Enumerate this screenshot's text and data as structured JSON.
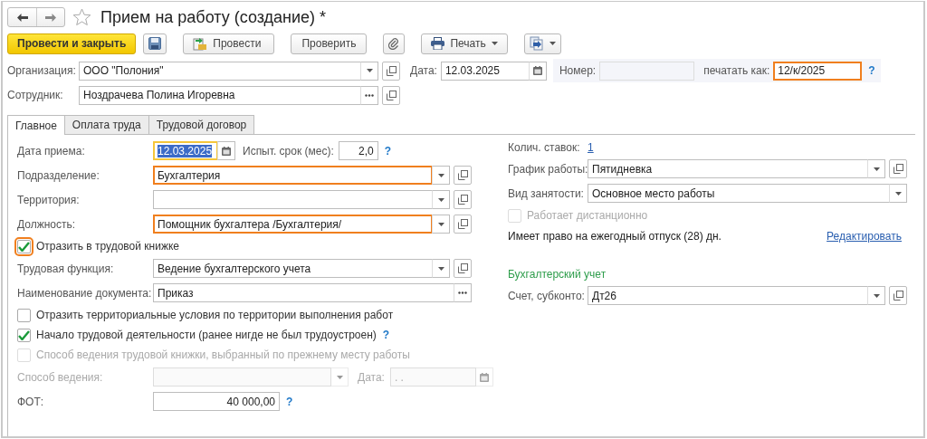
{
  "window": {
    "title": "Прием на работу (создание) *"
  },
  "toolbar": [
    {
      "kind": "primary",
      "label": "Провести и закрыть"
    },
    {
      "kind": "save"
    },
    {
      "kind": "post",
      "label": "Провести"
    },
    {
      "kind": "plain",
      "label": "Проверить"
    },
    {
      "kind": "attach"
    },
    {
      "kind": "print",
      "label": "Печать",
      "menu": true
    },
    {
      "kind": "exchange",
      "menu": true
    }
  ],
  "header": {
    "organization": {
      "label": "Организация:",
      "value": "ООО \"Полония\""
    },
    "date": {
      "label": "Дата:",
      "value": "12.03.2025"
    },
    "number": {
      "label": "Номер:"
    },
    "print_as": {
      "label": "печатать как:",
      "value": "12/к/2025",
      "highlighted": true,
      "help": "?"
    },
    "employee": {
      "label": "Сотрудник:",
      "value": "Ноздрачева Полина Игоревна"
    }
  },
  "tabs": [
    {
      "label": "Главное",
      "selected": true
    },
    {
      "label": "Оплата труда",
      "selected": false
    },
    {
      "label": "Трудовой договор",
      "selected": false
    }
  ],
  "main": {
    "hire_date": {
      "label": "Дата приема:",
      "value": "12.03.2025",
      "focused": true,
      "text_selected": true
    },
    "trial": {
      "label": "Испыт. срок (мес):",
      "value": "2,0",
      "help": "?"
    },
    "rows": [
      {
        "kind": "select",
        "label": "Подразделение:",
        "value": "Бухгалтерия",
        "highlighted": true,
        "open_button": true
      },
      {
        "kind": "select",
        "label": "Территория:",
        "open_button": true
      },
      {
        "kind": "select",
        "label": "Должность:",
        "value": "Помощник бухгалтера /Бухгалтерия/",
        "highlighted": true,
        "open_button": true
      },
      {
        "kind": "checkbox",
        "label": "Отразить в трудовой книжке",
        "checked": true,
        "highlighted": true,
        "disabled": false
      },
      {
        "kind": "select",
        "label": "Трудовая функция:",
        "value": "Ведение бухгалтерского учета",
        "open_button": true
      },
      {
        "kind": "choice",
        "label": "Наименование документа:",
        "value": "Приказ"
      },
      {
        "kind": "checkbox",
        "label": "Отразить территориальные условия по территории выполнения работ",
        "checked": false,
        "disabled": false
      },
      {
        "kind": "checkbox",
        "label": "Начало трудовой деятельности (ранее нигде не был трудоустроен)",
        "checked": true,
        "disabled": false,
        "help": "?"
      },
      {
        "kind": "checkbox",
        "label": "Способ ведения трудовой книжки, выбранный по прежнему месту работы",
        "checked": false,
        "disabled": true
      },
      {
        "kind": "method",
        "label": "Способ ведения:",
        "disabled": true,
        "date_label": "Дата:",
        "date_value": ".  ."
      },
      {
        "kind": "number",
        "label": "ФОТ:",
        "value": "40 000,00",
        "help": "?"
      }
    ]
  },
  "side": {
    "rate": {
      "label": "Колич. ставок:",
      "value": "1"
    },
    "rows": [
      {
        "kind": "select",
        "label": "График работы:",
        "value": "Пятидневка",
        "open_button": true
      },
      {
        "kind": "select",
        "label": "Вид занятости:",
        "value": "Основное место работы",
        "open_button": false
      },
      {
        "kind": "checkbox",
        "label": "Работает дистанционно",
        "checked": false,
        "disabled": true
      }
    ],
    "vacation": {
      "text": "Имеет право на ежегодный отпуск (28) дн.",
      "link": "Редактировать"
    },
    "accounting": {
      "heading": "Бухгалтерский учет",
      "label": "Счет, субконто:",
      "value": "Дт26"
    }
  }
}
